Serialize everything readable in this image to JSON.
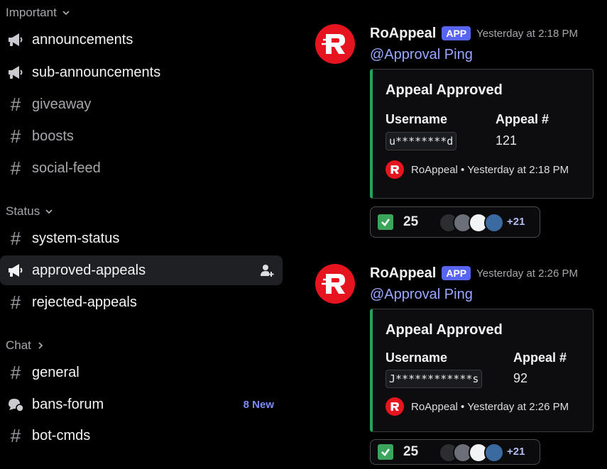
{
  "sidebar": {
    "categories": [
      {
        "label": "Important",
        "chevron": "chevron-down-icon"
      },
      {
        "label": "Status",
        "chevron": "chevron-down-icon"
      },
      {
        "label": "Chat",
        "chevron": "chevron-right-icon"
      }
    ],
    "channels": [
      {
        "name": "announcements",
        "icon": "megaphone-icon"
      },
      {
        "name": "sub-announcements",
        "icon": "megaphone-icon"
      },
      {
        "name": "giveaway",
        "icon": "hash-icon"
      },
      {
        "name": "boosts",
        "icon": "hash-icon"
      },
      {
        "name": "social-feed",
        "icon": "hash-icon"
      },
      {
        "name": "system-status",
        "icon": "hash-icon"
      },
      {
        "name": "approved-appeals",
        "icon": "megaphone-icon",
        "active": true,
        "action_icon": "add-member-icon"
      },
      {
        "name": "rejected-appeals",
        "icon": "hash-icon"
      },
      {
        "name": "general",
        "icon": "hash-icon"
      },
      {
        "name": "bans-forum",
        "icon": "forum-icon",
        "badge": "8 New"
      },
      {
        "name": "bot-cmds",
        "icon": "hash-icon"
      }
    ]
  },
  "messages": [
    {
      "author": "RoAppeal",
      "app_tag": "APP",
      "timestamp": "Yesterday at 2:18 PM",
      "mention": "@Approval Ping",
      "embed": {
        "title": "Appeal Approved",
        "field1_name": "Username",
        "field1_value": "u********d",
        "field2_name": "Appeal #",
        "field2_value": "121",
        "footer_name": "RoAppeal",
        "footer_time": "Yesterday at 2:18 PM"
      },
      "reaction": {
        "emoji": "check-mark-icon",
        "count": "25",
        "more": "+21"
      }
    },
    {
      "author": "RoAppeal",
      "app_tag": "APP",
      "timestamp": "Yesterday at 2:26 PM",
      "mention": "@Approval Ping",
      "embed": {
        "title": "Appeal Approved",
        "field1_name": "Username",
        "field1_value": "J************s",
        "field2_name": "Appeal #",
        "field2_value": "92",
        "footer_name": "RoAppeal",
        "footer_time": "Yesterday at 2:26 PM"
      },
      "reaction": {
        "emoji": "check-mark-icon",
        "count": "25",
        "more": "+21"
      }
    }
  ],
  "colors": {
    "background": "#000000",
    "brand_red": "#e5141e",
    "app_tag": "#5865f2",
    "mention": "#9aa7ff",
    "embed_accent": "#23a55a",
    "new_badge": "#7c8cf2"
  }
}
